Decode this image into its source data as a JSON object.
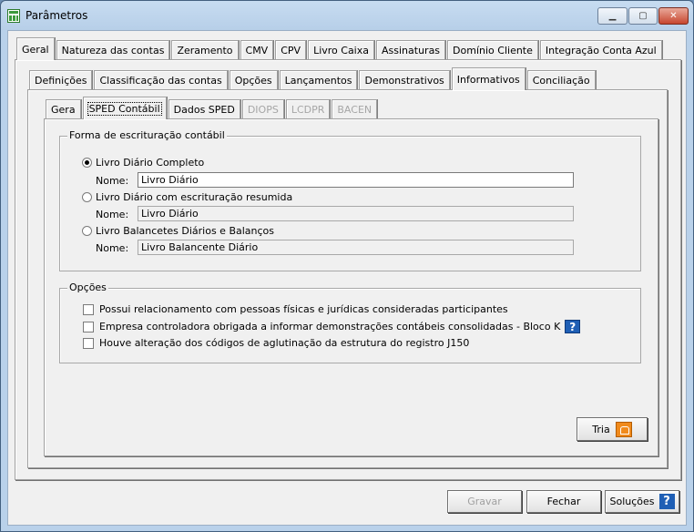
{
  "window": {
    "title": "Parâmetros",
    "minimize": "▁",
    "maximize": "▢",
    "close": "✕"
  },
  "tabs_main": [
    "Geral",
    "Natureza das contas",
    "Zeramento",
    "CMV",
    "CPV",
    "Livro Caixa",
    "Assinaturas",
    "Domínio Cliente",
    "Integração Conta Azul"
  ],
  "tabs_sub": [
    "Definições",
    "Classificação das contas",
    "Opções",
    "Lançamentos",
    "Demonstrativos",
    "Informativos",
    "Conciliação"
  ],
  "tabs_inner": [
    "Gera",
    "SPED Contábil",
    "Dados SPED",
    "DIOPS",
    "LCDPR",
    "BACEN"
  ],
  "escrituracao": {
    "legend": "Forma de escrituração contábil",
    "nome_label": "Nome:",
    "options": [
      {
        "label": "Livro Diário Completo",
        "selected": true,
        "nome": "Livro Diário"
      },
      {
        "label": "Livro Diário com escrituração resumida",
        "selected": false,
        "nome": "Livro Diário"
      },
      {
        "label": "Livro Balancetes Diários e Balanços",
        "selected": false,
        "nome": "Livro Balancente Diário"
      }
    ]
  },
  "opcoes": {
    "legend": "Opções",
    "items": [
      {
        "label": "Possui relacionamento com pessoas físicas e jurídicas consideradas participantes",
        "checked": false
      },
      {
        "label": "Empresa controladora obrigada a informar demonstrações contábeis consolidadas - Bloco K",
        "checked": false,
        "help": "?"
      },
      {
        "label": "Houve alteração dos códigos de aglutinação da estrutura do registro J150",
        "checked": false
      }
    ]
  },
  "buttons": {
    "tria": "Tria",
    "gravar": "Gravar",
    "fechar": "Fechar",
    "solucoes": "Soluções",
    "solucoes_icon": "?"
  },
  "colors": {
    "title_bar": "#b9d1ea",
    "help_blue": "#1f5fb5",
    "tria_orange": "#f08a1c"
  }
}
